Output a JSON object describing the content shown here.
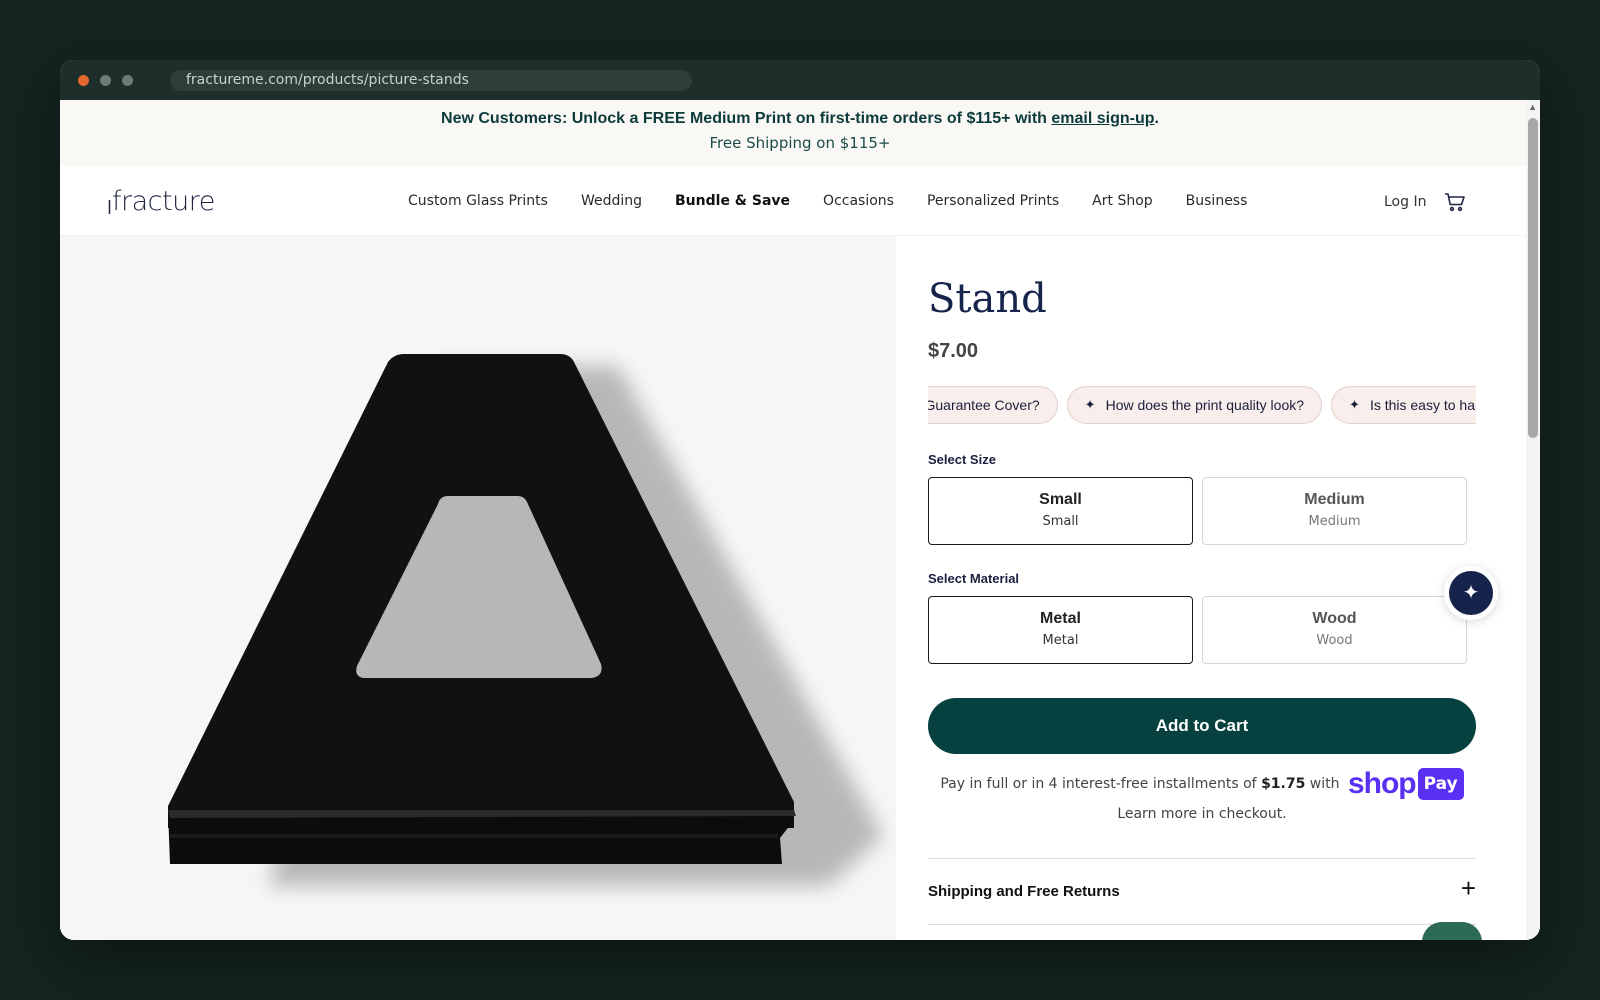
{
  "browser": {
    "url": "fractureme.com/products/picture-stands"
  },
  "promo": {
    "line1_prefix": "New Customers: Unlock a FREE Medium Print on first-time orders of $115+ with ",
    "line1_link": "email sign-up",
    "line1_suffix": ".",
    "line2": "Free Shipping on $115+"
  },
  "nav": {
    "logo": "fracture",
    "links": [
      "Custom Glass Prints",
      "Wedding",
      "Bundle & Save",
      "Occasions",
      "Personalized Prints",
      "Art Shop",
      "Business"
    ],
    "login": "Log In",
    "cart_icon": "cart-icon"
  },
  "product": {
    "title": "Stand",
    "price": "$7.00",
    "chips": [
      "What Does the Guarantee Cover?",
      "How does the print quality look?",
      "Is this easy to hang?"
    ],
    "size_label": "Select Size",
    "sizes": [
      {
        "main": "Small",
        "sub": "Small",
        "selected": true
      },
      {
        "main": "Medium",
        "sub": "Medium",
        "selected": false
      }
    ],
    "material_label": "Select Material",
    "materials": [
      {
        "main": "Metal",
        "sub": "Metal",
        "selected": true
      },
      {
        "main": "Wood",
        "sub": "Wood",
        "selected": false
      }
    ],
    "add_to_cart": "Add to Cart",
    "installments_prefix": "Pay in full or in 4 interest-free installments of ",
    "installments_amount": "$1.75",
    "installments_suffix": " with",
    "shop_pay_shop": "shop",
    "shop_pay_pay": "Pay",
    "installments_line2": "Learn more in checkout.",
    "accordion_title": "Shipping and Free Returns"
  },
  "colors": {
    "brand_dark_teal": "#06403f",
    "navy": "#16234a",
    "shop_pay": "#5a31f4",
    "chip_bg": "#f8eeec"
  }
}
